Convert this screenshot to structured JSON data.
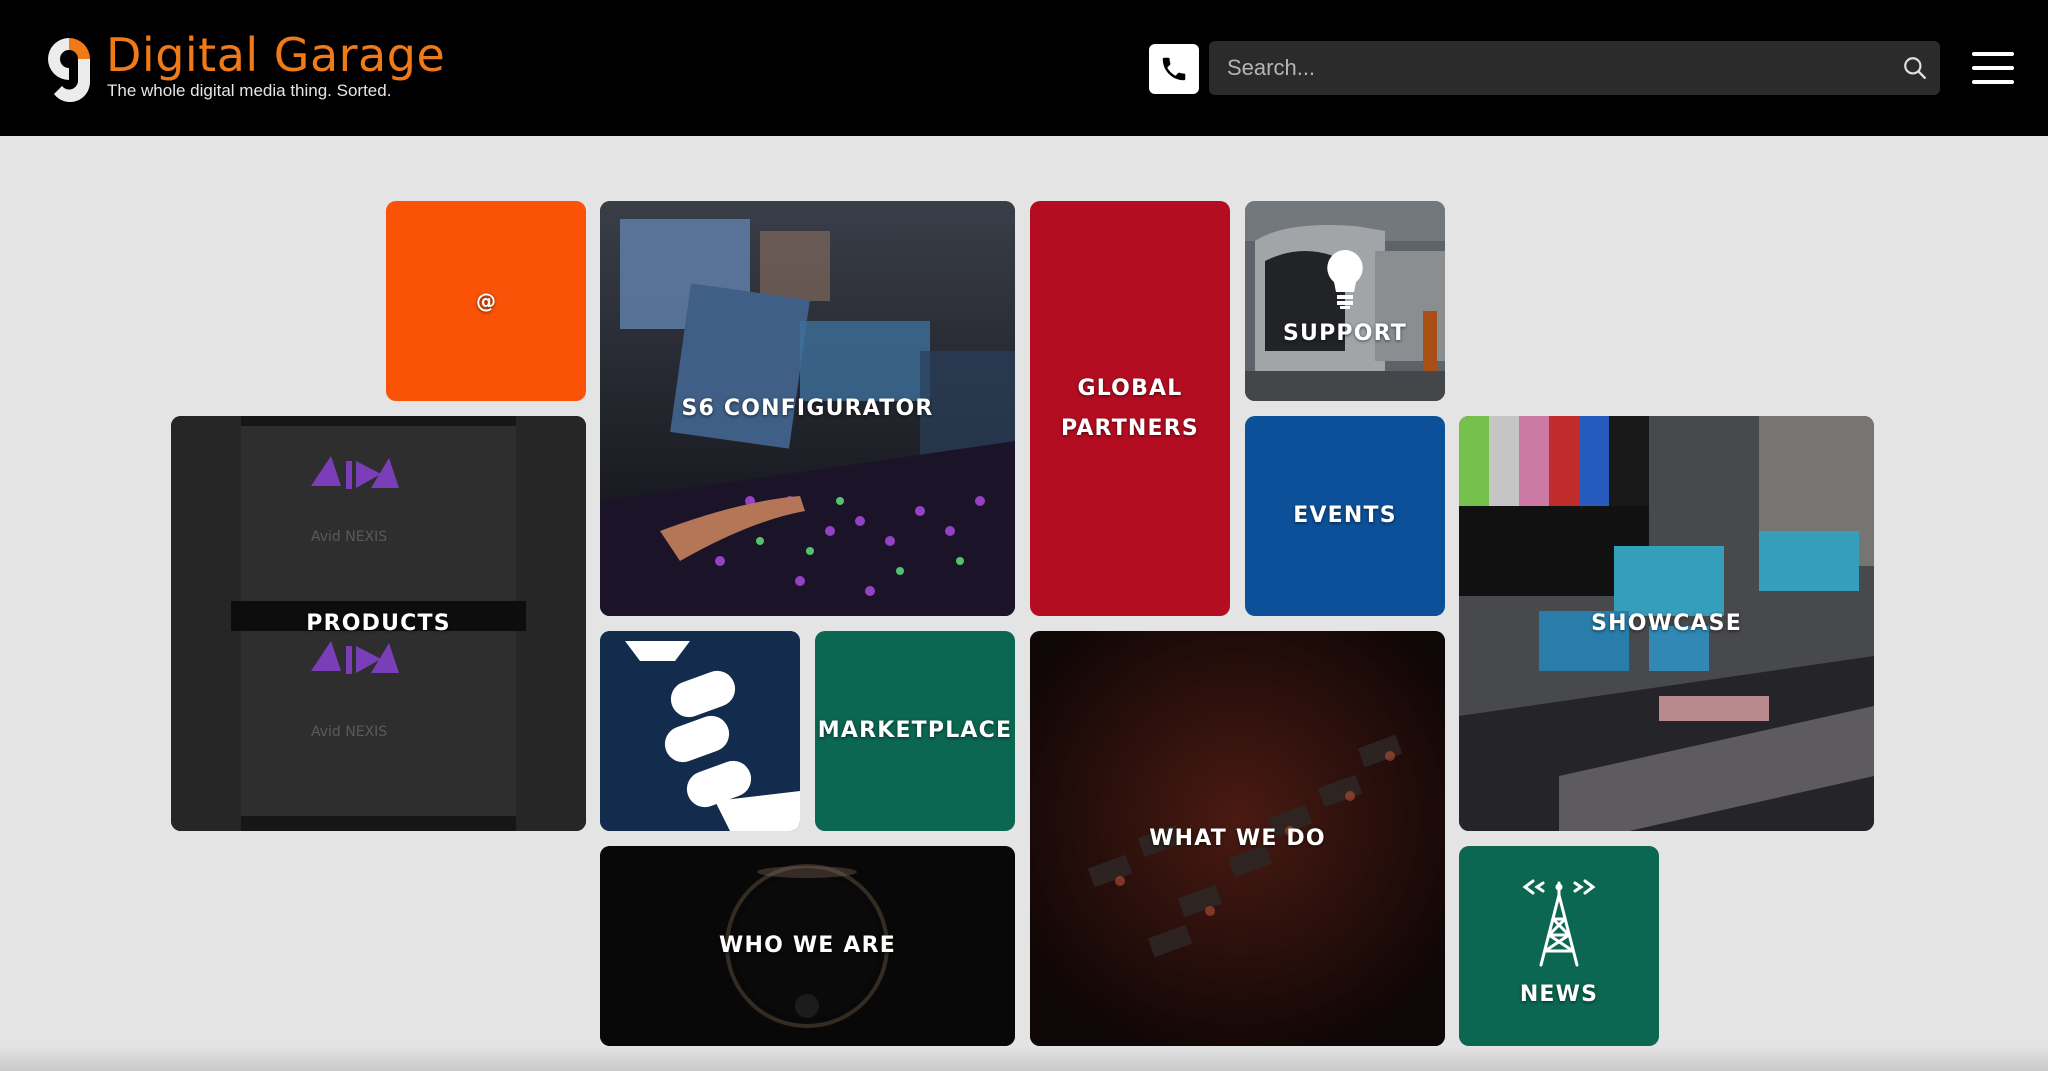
{
  "brand": {
    "name": "Digital Garage",
    "tagline": "The whole digital media thing. Sorted.",
    "accent_color": "#f07a18"
  },
  "header": {
    "search_placeholder": "Search...",
    "phone_icon": "phone-icon",
    "search_icon": "search-icon",
    "menu_icon": "hamburger-menu-icon"
  },
  "tiles": {
    "at": {
      "label": "@",
      "color": "#fa5308"
    },
    "s6_configurator": {
      "label": "S6 CONFIGURATOR"
    },
    "global_partners": {
      "line1": "GLOBAL",
      "line2": "PARTNERS",
      "color": "#b40d22"
    },
    "support": {
      "label": "SUPPORT",
      "icon": "lightbulb-icon"
    },
    "events": {
      "label": "EVENTS",
      "color": "#0c5099"
    },
    "products": {
      "label": "PRODUCTS"
    },
    "showcase": {
      "label": "SHOWCASE"
    },
    "avid_logo": {
      "icon": "avid-stripes-logo"
    },
    "marketplace": {
      "label": "MARKETPLACE",
      "color": "#0b6752"
    },
    "what_we_do": {
      "label": "WHAT WE DO"
    },
    "who_we_are": {
      "label": "WHO WE ARE"
    },
    "news": {
      "label": "NEWS",
      "icon": "radio-tower-icon",
      "color": "#0b6752"
    }
  }
}
